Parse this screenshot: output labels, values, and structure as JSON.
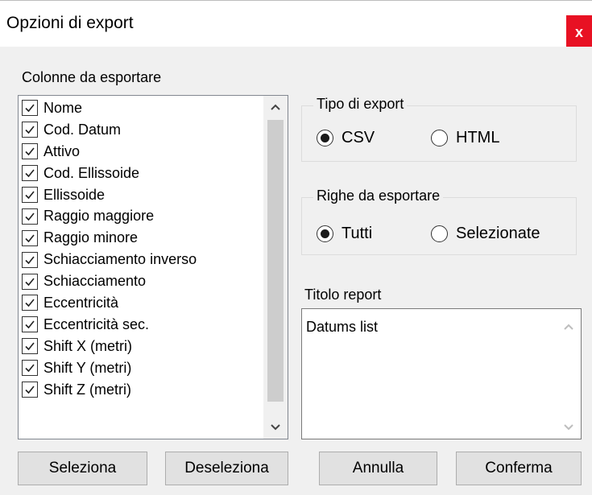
{
  "window": {
    "title": "Opzioni di export",
    "close_glyph": "x"
  },
  "columns_section": {
    "label": "Colonne da esportare",
    "items": [
      {
        "label": "Nome",
        "checked": true
      },
      {
        "label": "Cod. Datum",
        "checked": true
      },
      {
        "label": "Attivo",
        "checked": true
      },
      {
        "label": "Cod. Ellissoide",
        "checked": true
      },
      {
        "label": "Ellissoide",
        "checked": true
      },
      {
        "label": "Raggio maggiore",
        "checked": true
      },
      {
        "label": "Raggio minore",
        "checked": true
      },
      {
        "label": "Schiacciamento inverso",
        "checked": true
      },
      {
        "label": "Schiacciamento",
        "checked": true
      },
      {
        "label": "Eccentricità",
        "checked": true
      },
      {
        "label": "Eccentricità sec.",
        "checked": true
      },
      {
        "label": "Shift X (metri)",
        "checked": true
      },
      {
        "label": "Shift Y (metri)",
        "checked": true
      },
      {
        "label": "Shift Z (metri)",
        "checked": true
      }
    ],
    "scroll_up_glyph": "^",
    "scroll_down_glyph": "v"
  },
  "export_type": {
    "label": "Tipo di export",
    "options": [
      {
        "label": "CSV",
        "selected": true
      },
      {
        "label": "HTML",
        "selected": false
      }
    ]
  },
  "rows_to_export": {
    "label": "Righe da esportare",
    "options": [
      {
        "label": "Tutti",
        "selected": true
      },
      {
        "label": "Selezionate",
        "selected": false
      }
    ]
  },
  "report_title": {
    "label": "Titolo report",
    "value": "Datums list"
  },
  "buttons": {
    "select": "Seleziona",
    "deselect": "Deseleziona",
    "cancel": "Annulla",
    "confirm": "Conferma"
  }
}
